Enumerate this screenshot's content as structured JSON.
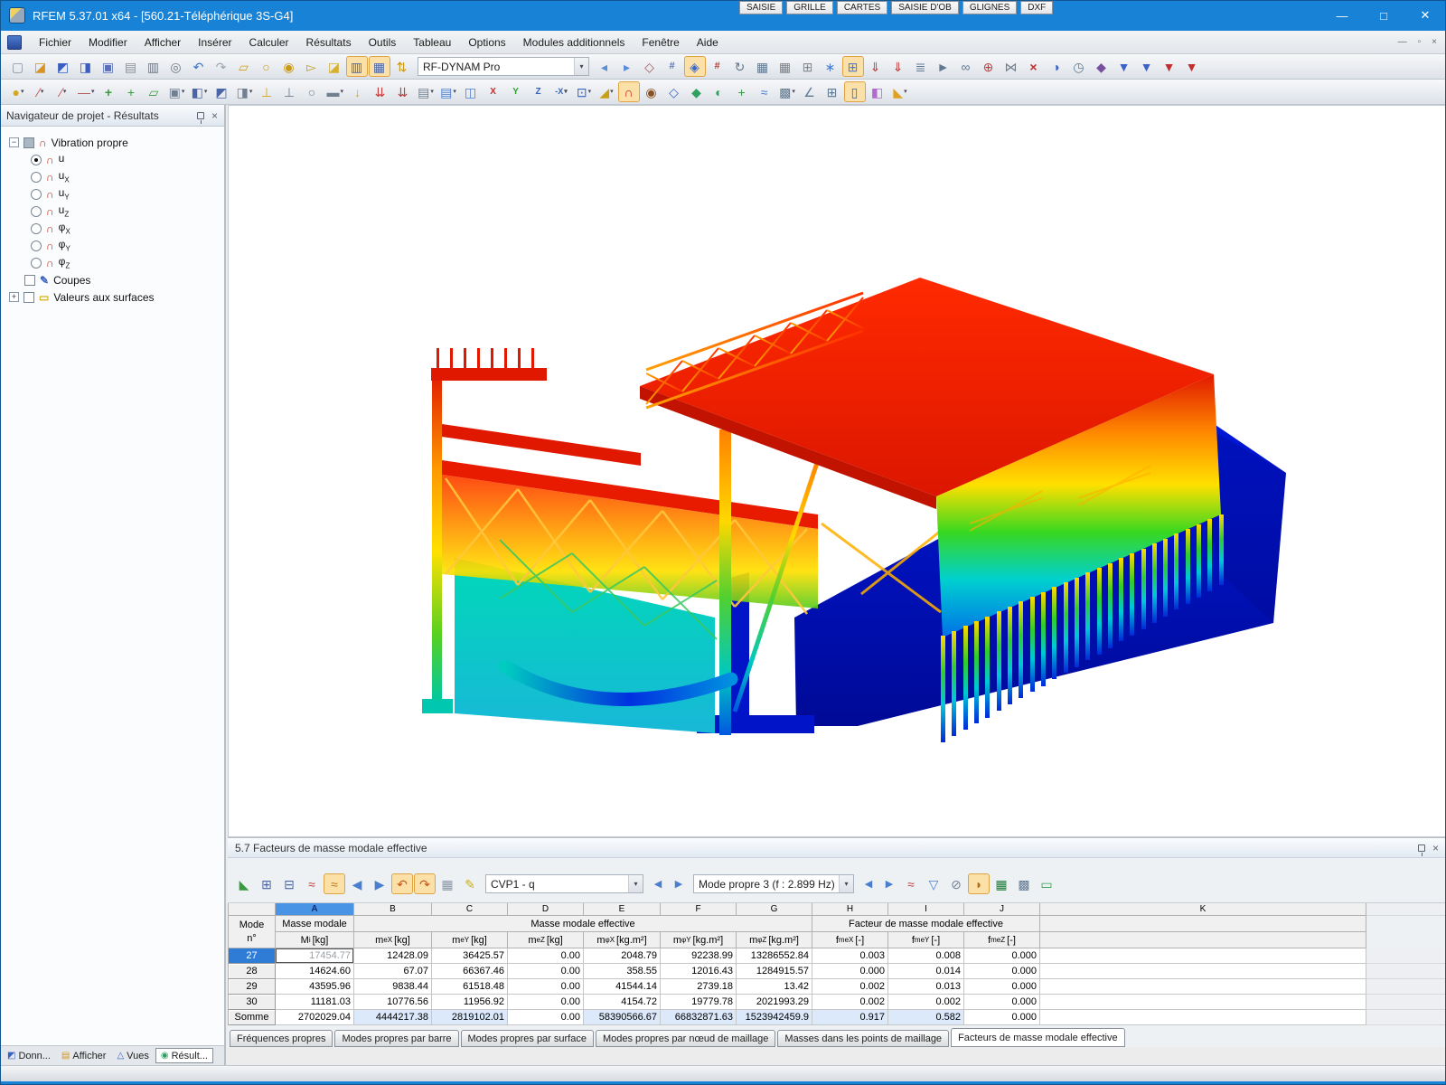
{
  "window": {
    "title": "RFEM 5.37.01 x64 - [560.21-Téléphérique 3S-G4]",
    "minimize_glyph": "—",
    "maximize_glyph": "□",
    "close_glyph": "✕"
  },
  "menu": {
    "items": [
      "Fichier",
      "Modifier",
      "Afficher",
      "Insérer",
      "Calculer",
      "Résultats",
      "Outils",
      "Tableau",
      "Options",
      "Modules additionnels",
      "Fenêtre",
      "Aide"
    ],
    "mdi_minimize": "—",
    "mdi_restore": "▫",
    "mdi_close": "×"
  },
  "toolbar1": {
    "combo_value": "RF-DYNAM Pro",
    "combo_caret": "▾",
    "icons_a": [
      {
        "n": "new-model-icon",
        "g": "▢",
        "css": "color:#8893a0"
      },
      {
        "n": "open-model-icon",
        "g": "◪",
        "css": "color:#d79422"
      },
      {
        "n": "import-icon",
        "g": "◩",
        "css": "color:#3a5fc0"
      },
      {
        "n": "export-icon",
        "g": "◨",
        "css": "color:#3a5fc0"
      },
      {
        "n": "save-icon",
        "g": "▣",
        "css": "color:#5a6fb8"
      },
      {
        "n": "clipboard-icon",
        "g": "▤",
        "css": "color:#8a8f98"
      },
      {
        "n": "print-icon",
        "g": "▥",
        "css": "color:#6f7781"
      },
      {
        "n": "print-preview-icon",
        "g": "◎",
        "css": "color:#6f7781"
      },
      {
        "n": "undo-icon",
        "g": "↶",
        "css": "color:#3a6fd0"
      },
      {
        "n": "redo-icon",
        "g": "↷",
        "css": "color:#9aa4b0"
      },
      {
        "n": "edit-polygon-icon",
        "g": "▱",
        "css": "color:#d0a018"
      },
      {
        "n": "zoom-window-icon",
        "g": "○",
        "css": "color:#c89a18"
      },
      {
        "n": "zoom-center-icon",
        "g": "◉",
        "css": "color:#c89a18"
      },
      {
        "n": "pick-objects-icon",
        "g": "▻",
        "css": "color:#c89a18"
      },
      {
        "n": "new-window-icon",
        "g": "◪",
        "css": "color:#d8b030"
      },
      {
        "n": "navigator-panel-toggle-icon",
        "g": "▥",
        "css": "color:#4a66a8;background:#fbe0a8;border:1px solid #e0a343"
      },
      {
        "n": "tables-panel-toggle-icon",
        "g": "▦",
        "css": "color:#4a66a8;background:#fbe0a8;border:1px solid #e0a343"
      },
      {
        "n": "renumber-icon",
        "g": "⇅",
        "css": "color:#c89a18"
      }
    ],
    "icons_b": [
      {
        "n": "nav-back-icon",
        "g": "◂",
        "css": "color:#5b8dd6"
      },
      {
        "n": "nav-forward-icon",
        "g": "▸",
        "css": "color:#5b8dd6"
      },
      {
        "n": "dimension-icon",
        "g": "◇",
        "css": "color:#a05858"
      },
      {
        "n": "values-xx-icon",
        "g": "#",
        "css": "color:#5a77b0;font-size:11px;font-weight:bold"
      },
      {
        "n": "show-values-icon",
        "g": "◈",
        "css": "color:#3a66c8;background:#fbe0a8;border:1px solid #e0a343"
      },
      {
        "n": "values-xxx-icon",
        "g": "#",
        "css": "color:#b04040;font-size:11px;font-weight:bold"
      },
      {
        "n": "rotate-view-icon",
        "g": "↻",
        "css": "color:#607890"
      },
      {
        "n": "goto-table-icon",
        "g": "▦",
        "css": "color:#607890"
      },
      {
        "n": "goto-graphic-icon",
        "g": "▦",
        "css": "color:#78808a"
      },
      {
        "n": "mesh-icon",
        "g": "⊞",
        "css": "color:#808890"
      },
      {
        "n": "mesh-settings-icon",
        "g": "∗",
        "css": "color:#4a7fd0"
      },
      {
        "n": "mesh-show-icon",
        "g": "⊞",
        "css": "color:#4a7fd0;background:#fbe0a8;border:1px solid #e0a343"
      },
      {
        "n": "load-case-icon",
        "g": "⇓",
        "css": "color:#c03838"
      },
      {
        "n": "load-combination-icon",
        "g": "⇓",
        "css": "color:#c03838"
      },
      {
        "n": "load-table-icon",
        "g": "≣",
        "css": "color:#607890"
      },
      {
        "n": "flag-icon",
        "g": "►",
        "css": "color:#607890"
      },
      {
        "n": "chain-icon",
        "g": "∞",
        "css": "color:#607890"
      },
      {
        "n": "axes-icon",
        "g": "⊕",
        "css": "color:#c04040"
      },
      {
        "n": "mirror-icon",
        "g": "⋈",
        "css": "color:#708090"
      },
      {
        "n": "delete-icon",
        "g": "×",
        "css": "color:#c03030;font-weight:bold"
      },
      {
        "n": "info-icon",
        "g": "◑",
        "css": "color:#3a66c8"
      },
      {
        "n": "history-icon",
        "g": "◷",
        "css": "color:#607890"
      },
      {
        "n": "connect-icon",
        "g": "◆",
        "css": "color:#7850a0"
      },
      {
        "n": "result-nav-x-icon",
        "g": "▼",
        "css": "color:#3a62c8"
      },
      {
        "n": "result-nav-y-icon",
        "g": "▼",
        "css": "color:#3a62c8"
      },
      {
        "n": "result-nav-z-icon",
        "g": "▼",
        "css": "color:#c03030"
      },
      {
        "n": "result-nav-sum-icon",
        "g": "▼",
        "css": "color:#c03030"
      }
    ]
  },
  "toolbar2": {
    "icons": [
      {
        "n": "node-tool-icon",
        "g": "●",
        "css": "color:#d8a818",
        "caret": "▾"
      },
      {
        "n": "line-tool-icon",
        "g": "∕",
        "css": "color:#c05050",
        "caret": "▾"
      },
      {
        "n": "arc-tool-icon",
        "g": "∕",
        "css": "color:#c05050",
        "caret": "▾"
      },
      {
        "n": "member-tool-icon",
        "g": "—",
        "css": "color:#b05050",
        "caret": "▾"
      },
      {
        "n": "node-generator-icon",
        "g": "+",
        "css": "color:#3a9a40;font-weight:bold"
      },
      {
        "n": "line-generator-icon",
        "g": "+",
        "css": "color:#3a9a40"
      },
      {
        "n": "surface-tool-icon",
        "g": "▱",
        "css": "color:#3a9a40"
      },
      {
        "n": "opening-tool-icon",
        "g": "▣",
        "css": "color:#708090",
        "caret": "▾"
      },
      {
        "n": "solid-tool-icon",
        "g": "◧",
        "css": "color:#4a66a8",
        "caret": "▾"
      },
      {
        "n": "surface-type-icon",
        "g": "◩",
        "css": "color:#4a66a8"
      },
      {
        "n": "model-generator-icon",
        "g": "◨",
        "css": "color:#708090",
        "caret": "▾"
      },
      {
        "n": "nodal-support-icon",
        "g": "⊥",
        "css": "color:#d8a818"
      },
      {
        "n": "line-support-icon",
        "g": "⊥",
        "css": "color:#708090"
      },
      {
        "n": "member-hinge-icon",
        "g": "○",
        "css": "color:#708090"
      },
      {
        "n": "surface-support-icon",
        "g": "▬",
        "css": "color:#708090",
        "caret": "▾"
      },
      {
        "n": "nodal-load-icon",
        "g": "↓",
        "css": "color:#d8a818;font-weight:bold"
      },
      {
        "n": "member-load-icon",
        "g": "⇊",
        "css": "color:#c04040"
      },
      {
        "n": "surface-load-icon",
        "g": "⇊",
        "css": "color:#c04040"
      },
      {
        "n": "load-generator-icon",
        "g": "▤",
        "css": "color:#708090",
        "caret": "▾"
      },
      {
        "n": "selection-icon",
        "g": "▤",
        "css": "color:#4a7fd0",
        "caret": "▾"
      },
      {
        "n": "special-selection-icon",
        "g": "◫",
        "css": "color:#4a7fd0"
      },
      {
        "n": "view-x-icon",
        "g": "X",
        "css": "color:#c03030;font-size:10px;font-weight:bold"
      },
      {
        "n": "view-y-icon",
        "g": "Y",
        "css": "color:#30a030;font-size:10px;font-weight:bold"
      },
      {
        "n": "view-z-icon",
        "g": "Z",
        "css": "color:#3060c0;font-size:10px;font-weight:bold"
      },
      {
        "n": "view-minus-x-icon",
        "g": "-X",
        "css": "color:#3060c0;font-size:9px;font-weight:bold",
        "caret": "▾"
      },
      {
        "n": "work-plane-icon",
        "g": "⊡",
        "css": "color:#3a66c8",
        "caret": "▾"
      },
      {
        "n": "snap-grid-icon",
        "g": "◢",
        "css": "color:#c8a018",
        "caret": "▾"
      },
      {
        "n": "mode-shape-display-icon",
        "g": "∩",
        "css": "color:#c42518;background:#fbe0a8;border:1px solid #e0a343"
      },
      {
        "n": "animate-icon",
        "g": "◉",
        "css": "color:#8a5020"
      },
      {
        "n": "isometric-view-icon",
        "g": "◇",
        "css": "color:#3a66c8"
      },
      {
        "n": "render-mode-icon",
        "g": "◆",
        "css": "color:#30a060"
      },
      {
        "n": "shading-icon",
        "g": "◐",
        "css": "color:#30a060"
      },
      {
        "n": "visibility-icon",
        "g": "+",
        "css": "color:#3a9a40"
      },
      {
        "n": "clipping-plane-icon",
        "g": "≈",
        "css": "color:#4a7fd0"
      },
      {
        "n": "block-display-icon",
        "g": "▩",
        "css": "color:#607890",
        "caret": "▾"
      },
      {
        "n": "measure-icon",
        "g": "∠",
        "css": "color:#607890"
      },
      {
        "n": "table-grid-icon",
        "g": "⊞",
        "css": "color:#607890"
      },
      {
        "n": "panel-toggle-icon",
        "g": "▯",
        "css": "color:#3a66c8;background:#fbe0a8;border:1px solid #e0a343"
      },
      {
        "n": "color-scale-icon",
        "g": "◧",
        "css": "color:#b06ad0"
      },
      {
        "n": "legend-icon",
        "g": "◣",
        "css": "color:#e0a020",
        "caret": "▾"
      }
    ]
  },
  "navigator": {
    "title": "Navigateur de projet - Résultats",
    "close_glyph": "×",
    "tree": {
      "collapse_glyph": "−",
      "expand_glyph": "+",
      "mode_icon_glyph": "∩",
      "root_label": "Vibration propre",
      "modes": [
        {
          "b": "u",
          "s": "",
          "dot": "background:#111"
        },
        {
          "b": "u",
          "s": "X"
        },
        {
          "b": "u",
          "s": "Y"
        },
        {
          "b": "u",
          "s": "Z"
        },
        {
          "b": "φ",
          "s": "X"
        },
        {
          "b": "φ",
          "s": "Y"
        },
        {
          "b": "φ",
          "s": "Z"
        }
      ],
      "coupes_label": "Coupes",
      "valeurs_label": "Valeurs aux surfaces"
    },
    "tabs": [
      {
        "label": "Donn...",
        "g": "◩",
        "css": "color:#3a62c0"
      },
      {
        "label": "Afficher",
        "g": "▤",
        "css": "color:#d79422"
      },
      {
        "label": "Vues",
        "g": "△",
        "css": "color:#3a62c0"
      },
      {
        "label": "Résult...",
        "g": "◉",
        "css": "color:#30a060",
        "tabcss": "background:#ffffff;border:1px solid #8a9099"
      }
    ]
  },
  "table": {
    "title": "5.7 Facteurs de masse modale effective",
    "close_glyph": "×",
    "toolbar": {
      "loadcase_combo": "CVP1 - q",
      "mode_combo": "Mode propre 3 (f : 2.899 Hz)",
      "combo_caret": "▾",
      "prev_glyph": "◀",
      "next_glyph": "▶",
      "icons_left": [
        {
          "n": "print-graphic-icon",
          "g": "◣",
          "css": "color:#3a9a40"
        },
        {
          "n": "insert-row-icon",
          "g": "⊞",
          "css": "color:#4a66a8"
        },
        {
          "n": "delete-row-icon",
          "g": "⊟",
          "css": "color:#4a66a8"
        },
        {
          "n": "result-diagram-icon",
          "g": "≈",
          "css": "color:#c04040"
        },
        {
          "n": "filter-modes-icon",
          "g": "≈",
          "css": "color:#c07818;background:#fbe0a8;border:1px solid #e0a343"
        },
        {
          "n": "previous-table-icon",
          "g": "◀",
          "css": "color:#4a7fd0"
        },
        {
          "n": "next-table-icon",
          "g": "▶",
          "css": "color:#4a7fd0"
        },
        {
          "n": "view-mode-icon",
          "g": "↶",
          "css": "color:#c05818;background:#fbe0a8;border:1px solid #e0a343"
        },
        {
          "n": "sync-selection-icon",
          "g": "↷",
          "css": "color:#c05818;background:#fbe0a8;border:1px solid #e0a343"
        },
        {
          "n": "table-display-icon",
          "g": "▦",
          "css": "color:#8a97a6"
        },
        {
          "n": "table-edit-icon",
          "g": "✎",
          "css": "color:#c8b018"
        }
      ],
      "icons_right": [
        {
          "n": "result-curve-icon",
          "g": "≈",
          "css": "color:#c04040"
        },
        {
          "n": "table-filter-icon",
          "g": "▽",
          "css": "color:#4a7fd0"
        },
        {
          "n": "zero-values-icon",
          "g": "⊘",
          "css": "color:#708090"
        },
        {
          "n": "pan-table-icon",
          "g": "◗",
          "css": "color:#b07018;background:#fbe0a8;border:1px solid #e0a343"
        },
        {
          "n": "excel-export-icon",
          "g": "▦",
          "css": "color:#1f7a38"
        },
        {
          "n": "calculator-icon",
          "g": "▩",
          "css": "color:#607890"
        },
        {
          "n": "units-settings-icon",
          "g": "▭",
          "css": "color:#30a050"
        }
      ]
    },
    "letters": [
      "A",
      "B",
      "C",
      "D",
      "E",
      "F",
      "G",
      "H",
      "I",
      "J",
      "K"
    ],
    "head": {
      "mode1": "Mode",
      "mode2": "n°",
      "a": "Masse modale",
      "bg": "Masse modale effective",
      "hj": "Facteur de masse modale effective"
    },
    "units": [
      {
        "b": "M",
        "s": "i",
        "u": "[kg]"
      },
      {
        "b": "m",
        "s": "eX",
        "u": "[kg]"
      },
      {
        "b": "m",
        "s": "eY",
        "u": "[kg]"
      },
      {
        "b": "m",
        "s": "eZ",
        "u": "[kg]"
      },
      {
        "b": "m",
        "s": "φX",
        "u": "[kg.m²]"
      },
      {
        "b": "m",
        "s": "φY",
        "u": "[kg.m²]"
      },
      {
        "b": "m",
        "s": "φZ",
        "u": "[kg.m²]"
      },
      {
        "b": "f",
        "s": "meX",
        "u": "[-]"
      },
      {
        "b": "f",
        "s": "meY",
        "u": "[-]"
      },
      {
        "b": "f",
        "s": "meZ",
        "u": "[-]"
      }
    ],
    "rows": [
      [
        "27",
        "17454.77",
        "12428.09",
        "36425.57",
        "0.00",
        "2048.79",
        "92238.99",
        "13286552.84",
        "0.003",
        "0.008",
        "0.000"
      ],
      [
        "28",
        "14624.60",
        "67.07",
        "66367.46",
        "0.00",
        "358.55",
        "12016.43",
        "1284915.57",
        "0.000",
        "0.014",
        "0.000"
      ],
      [
        "29",
        "43595.96",
        "9838.44",
        "61518.48",
        "0.00",
        "41544.14",
        "2739.18",
        "13.42",
        "0.002",
        "0.013",
        "0.000"
      ],
      [
        "30",
        "11181.03",
        "10776.56",
        "11956.92",
        "0.00",
        "4154.72",
        "19779.78",
        "2021993.29",
        "0.002",
        "0.002",
        "0.000"
      ]
    ],
    "sum": [
      "Somme",
      "2702029.04",
      "4444217.38",
      "2819102.01",
      "0.00",
      "58390566.67",
      "66832871.63",
      "1523942459.9",
      "0.917",
      "0.582",
      "0.000"
    ],
    "tabs": [
      {
        "label": "Fréquences propres"
      },
      {
        "label": "Modes propres par barre"
      },
      {
        "label": "Modes propres par surface"
      },
      {
        "label": "Modes propres par nœud de maillage"
      },
      {
        "label": "Masses dans les points de maillage"
      },
      {
        "label": "Facteurs de masse modale effective",
        "tabcss": "background:#ffffff;height:21px"
      }
    ]
  },
  "statusbar": {
    "buttons": [
      "SAISIE",
      "GRILLE",
      "CARTES",
      "SAISIE D'OB",
      "GLIGNES",
      "DXF"
    ]
  },
  "colors": {
    "titlebar_blue": "#1883d6",
    "selection_blue": "#2e7cd6",
    "active_tool_bg": "#fbe0a8",
    "sum_highlight": "#dbe9fb",
    "contour_max_red": "#e81800",
    "contour_yellow": "#ffe000",
    "contour_green": "#38d820",
    "contour_cyan": "#00d0d0",
    "contour_min_blue": "#000a96"
  }
}
